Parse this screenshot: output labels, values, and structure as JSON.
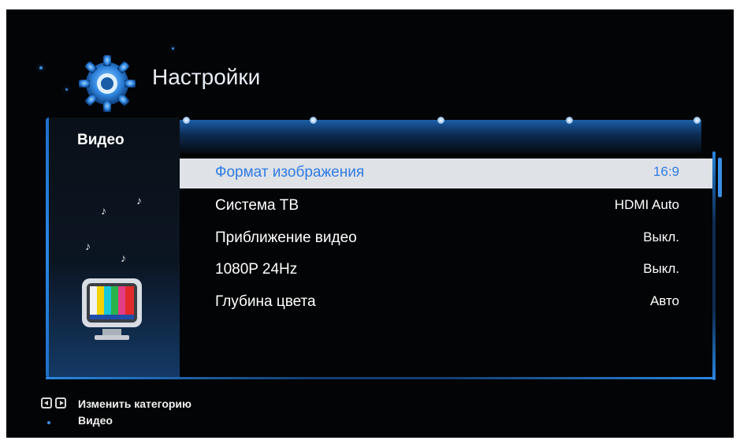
{
  "header": {
    "title": "Настройки",
    "icon": "gear-icon"
  },
  "sidebar": {
    "category": "Видео",
    "icon": "tv-icon"
  },
  "tabs": [
    "",
    "",
    "",
    ""
  ],
  "settings": [
    {
      "label": "Формат изображения",
      "value": "16:9",
      "selected": true
    },
    {
      "label": "Система ТВ",
      "value": "HDMI Auto",
      "selected": false
    },
    {
      "label": "Приближение видео",
      "value": "Выкл.",
      "selected": false
    },
    {
      "label": "1080P 24Hz",
      "value": "Выкл.",
      "selected": false
    },
    {
      "label": "Глубина цвета",
      "value": "Авто",
      "selected": false
    }
  ],
  "footer": {
    "hint": "Изменить категорию",
    "sub": "Видео"
  },
  "colors": {
    "accent": "#2f7be4",
    "selection_bg": "#dfe2e6",
    "background": "#030406"
  }
}
